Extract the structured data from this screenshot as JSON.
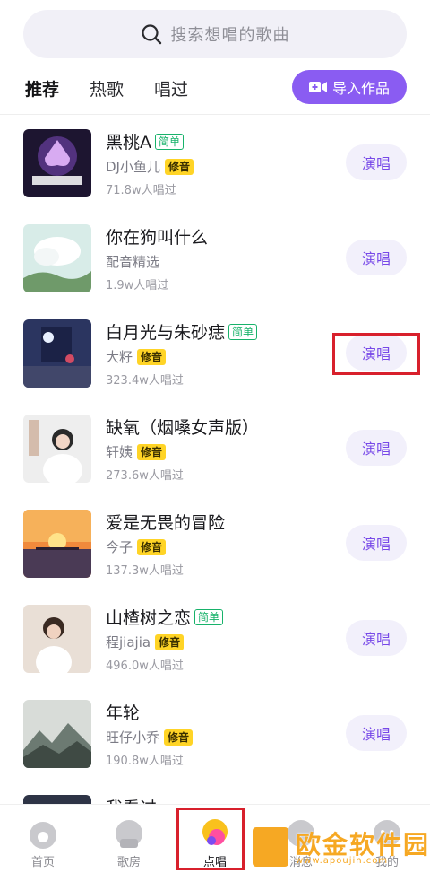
{
  "search": {
    "placeholder": "搜索想唱的歌曲"
  },
  "tabs": [
    {
      "label": "推荐",
      "active": true
    },
    {
      "label": "热歌",
      "active": false
    },
    {
      "label": "唱过",
      "active": false
    }
  ],
  "import_button": {
    "label": "导入作品"
  },
  "songs": [
    {
      "title": "黑桃A",
      "badge": "简单",
      "artist": "DJ小鱼儿",
      "tune": "修音",
      "plays": "71.8w人唱过",
      "action": "演唱",
      "cover": "cover-dark-spade"
    },
    {
      "title": "你在狗叫什么",
      "badge": "",
      "artist": "配音精选",
      "tune": "",
      "plays": "1.9w人唱过",
      "action": "演唱",
      "cover": "cover-clouds"
    },
    {
      "title": "白月光与朱砂痣",
      "badge": "简单",
      "artist": "大籽",
      "tune": "修音",
      "plays": "323.4w人唱过",
      "action": "演唱",
      "cover": "cover-night-room"
    },
    {
      "title": "缺氧（烟嗓女声版）",
      "badge": "",
      "artist": "轩姨",
      "tune": "修音",
      "plays": "273.6w人唱过",
      "action": "演唱",
      "cover": "cover-girl-white"
    },
    {
      "title": "爱是无畏的冒险",
      "badge": "",
      "artist": "今子",
      "tune": "修音",
      "plays": "137.3w人唱过",
      "action": "演唱",
      "cover": "cover-sunset-pier"
    },
    {
      "title": "山楂树之恋",
      "badge": "简单",
      "artist": "程jiajia",
      "tune": "修音",
      "plays": "496.0w人唱过",
      "action": "演唱",
      "cover": "cover-girl-portrait"
    },
    {
      "title": "年轮",
      "badge": "",
      "artist": "旺仔小乔",
      "tune": "修音",
      "plays": "190.8w人唱过",
      "action": "演唱",
      "cover": "cover-ink-mountain"
    },
    {
      "title": "我看过",
      "badge": "",
      "artist": "",
      "tune": "",
      "plays": "",
      "action": "",
      "cover": "cover-dark"
    }
  ],
  "bottom_nav": [
    {
      "label": "首页",
      "icon": "home-icon"
    },
    {
      "label": "歌房",
      "icon": "room-icon"
    },
    {
      "label": "点唱",
      "icon": "sing-icon",
      "active": true
    },
    {
      "label": "消息",
      "icon": "message-icon"
    },
    {
      "label": "我的",
      "icon": "profile-icon"
    }
  ],
  "watermark": {
    "text": "欧金软件园",
    "url": "www.apoujin.com"
  },
  "colors": {
    "accent": "#8a5cf2",
    "highlight": "#d8202c",
    "tab_underline": "#ffd426",
    "simple_badge": "#17b26a"
  }
}
